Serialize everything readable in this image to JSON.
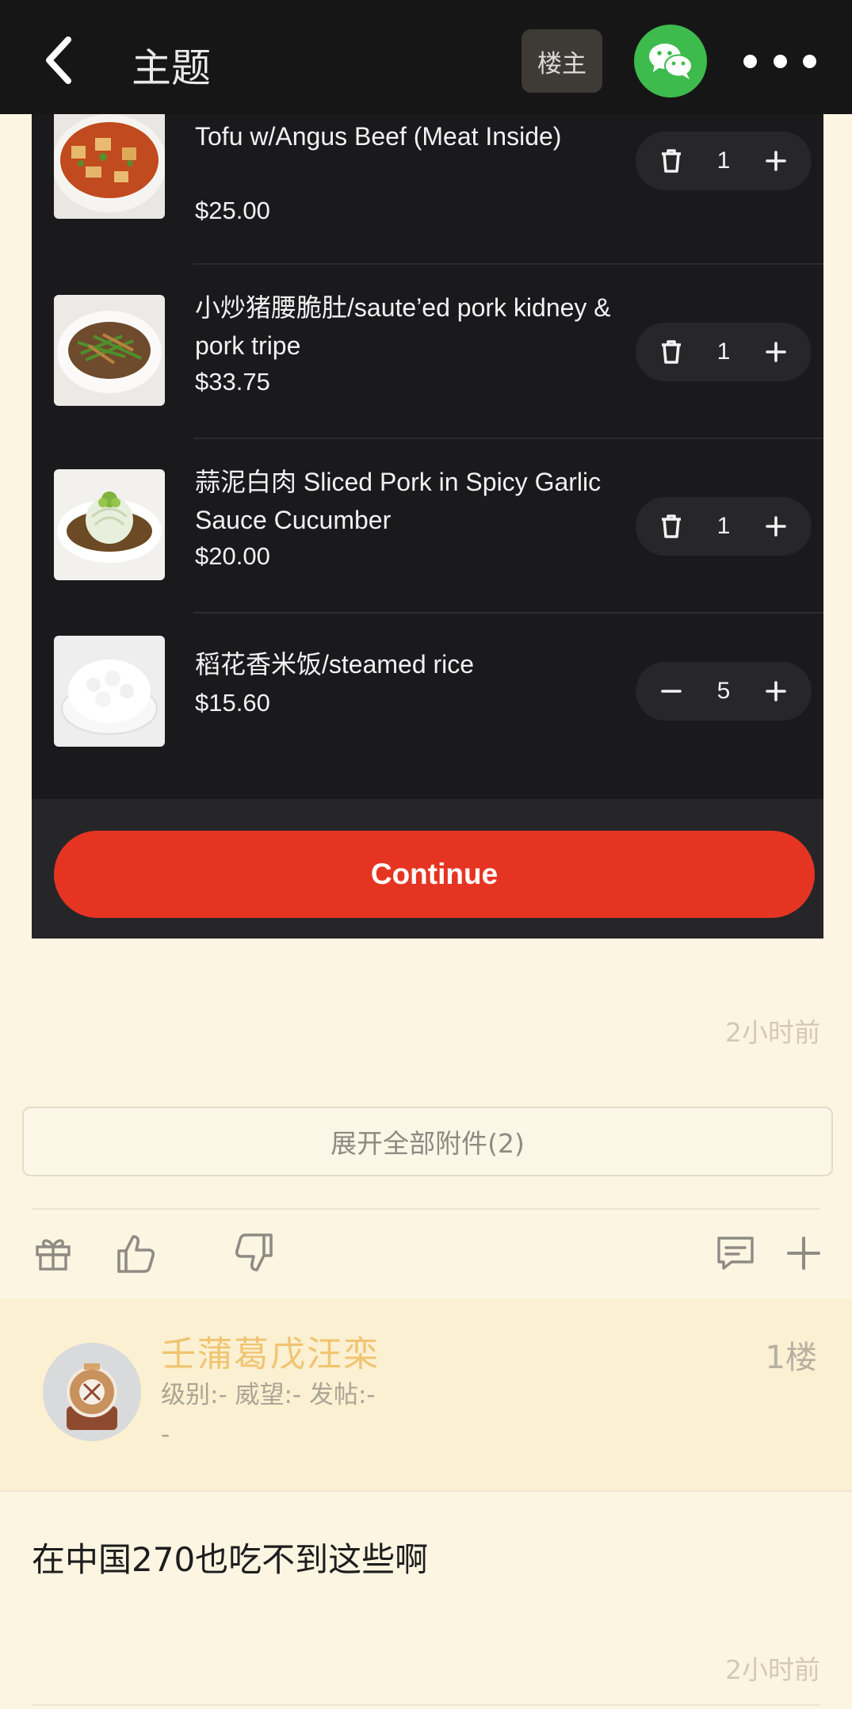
{
  "header": {
    "title": "主题",
    "op_badge": "楼主"
  },
  "order": {
    "items": [
      {
        "name": "Tofu w/Angus Beef (Meat Inside)",
        "price": "$25.00",
        "qty": "1"
      },
      {
        "name": "小炒猪腰脆肚/saute’ed pork kidney & pork tripe",
        "price": "$33.75",
        "qty": "1"
      },
      {
        "name": "蒜泥白肉 Sliced Pork in Spicy Garlic Sauce       Cucumber",
        "price": "$20.00",
        "qty": "1"
      },
      {
        "name": "稻花香米饭/steamed rice",
        "price": "$15.60",
        "qty": "5"
      }
    ],
    "continue_label": "Continue",
    "colors": {
      "accent": "#e53522",
      "background": "#1a1a1c"
    }
  },
  "post": {
    "time": "2小时前",
    "expand_label": "展开全部附件(2)"
  },
  "reply": {
    "user_name": "壬蒲葛戊汪栾",
    "user_meta": "级别:-  威望:-  发帖:-",
    "user_meta2": "-",
    "floor": "1楼",
    "text": "在中国270也吃不到这些啊",
    "time": "2小时前"
  }
}
